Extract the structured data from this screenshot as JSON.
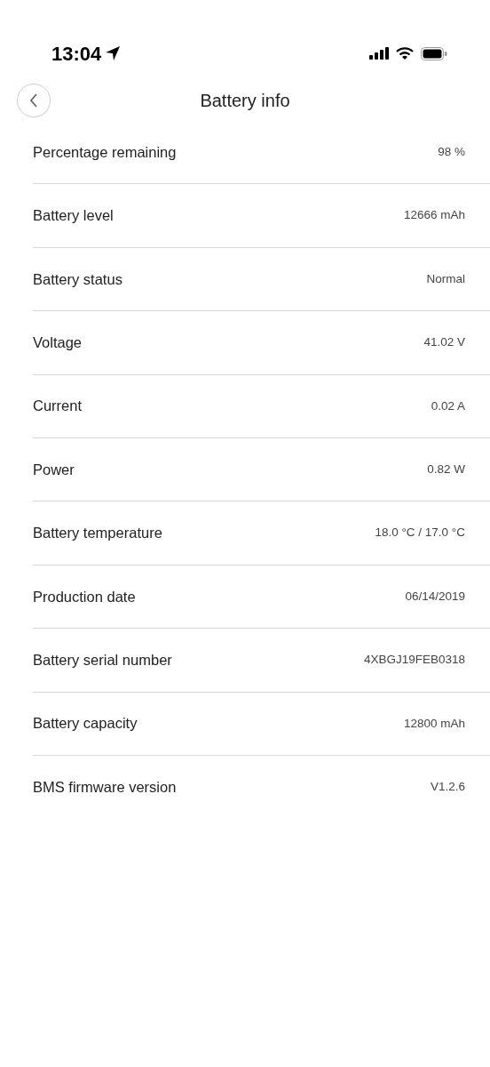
{
  "status_bar": {
    "time": "13:04"
  },
  "header": {
    "title": "Battery info"
  },
  "rows": [
    {
      "label": "Percentage remaining",
      "value": "98 %"
    },
    {
      "label": "Battery level",
      "value": "12666 mAh"
    },
    {
      "label": "Battery status",
      "value": "Normal"
    },
    {
      "label": "Voltage",
      "value": "41.02 V"
    },
    {
      "label": "Current",
      "value": "0.02 A"
    },
    {
      "label": "Power",
      "value": "0.82 W"
    },
    {
      "label": "Battery temperature",
      "value": "18.0 °C / 17.0 °C"
    },
    {
      "label": "Production date",
      "value": "06/14/2019"
    },
    {
      "label": "Battery serial number",
      "value": "4XBGJ19FEB0318"
    },
    {
      "label": "Battery capacity",
      "value": "12800 mAh"
    },
    {
      "label": "BMS firmware version",
      "value": "V1.2.6"
    }
  ]
}
